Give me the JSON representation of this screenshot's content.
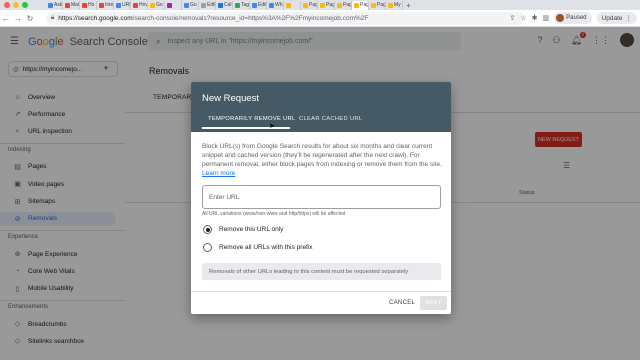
{
  "browser": {
    "tabs": [
      {
        "label": "Ask",
        "color": "#4285f4"
      },
      {
        "label": "Mai",
        "color": "#ea4335"
      },
      {
        "label": "Ho",
        "color": "#ea4335"
      },
      {
        "label": "Inte",
        "color": "#ea4335"
      },
      {
        "label": "URL",
        "color": "#4285f4"
      },
      {
        "label": "Hov",
        "color": "#ea4335"
      },
      {
        "label": "Go",
        "color": "#fbbc05"
      },
      {
        "label": "",
        "color": "#9c27b0"
      },
      {
        "label": "Go",
        "color": "#4285f4"
      },
      {
        "label": "Edit",
        "color": "#9e9e9e"
      },
      {
        "label": "Cal",
        "color": "#1a73e8"
      },
      {
        "label": "Tag",
        "color": "#34a853"
      },
      {
        "label": "Edit",
        "color": "#4285f4"
      },
      {
        "label": "Wh",
        "color": "#4285f4"
      },
      {
        "label": "",
        "color": "#fbbc05"
      },
      {
        "label": "Pag",
        "color": "#fbbc05"
      },
      {
        "label": "Pag",
        "color": "#fbbc05"
      },
      {
        "label": "Pag",
        "color": "#fbbc05"
      },
      {
        "label": "Pag",
        "color": "#fbbc05"
      },
      {
        "label": "Pag",
        "color": "#fbbc05"
      },
      {
        "label": "My",
        "color": "#fbbc05"
      }
    ],
    "new_tab": "+",
    "url_host": "https://search.google.com",
    "url_path": "/search-console/removals?resource_id=https%3A%2F%2Fmyincomejob.com%2F",
    "profile_label": "Paused",
    "update_label": "Update"
  },
  "header": {
    "logo_g": "G",
    "logo_o1": "o",
    "logo_o2": "o",
    "logo_g2": "g",
    "logo_l": "l",
    "logo_e": "e",
    "logo_rest": "Search Console",
    "search_placeholder": "Inspect any URL in \"https://myincomejob.com/\"",
    "notification_count": "2"
  },
  "sidebar": {
    "property": "https://myincomejo...",
    "items": [
      {
        "label": "Overview",
        "icon": "home-icon",
        "glyph": "⌂"
      },
      {
        "label": "Performance",
        "icon": "performance-icon",
        "glyph": "↗"
      },
      {
        "label": "URL inspection",
        "icon": "search-icon",
        "glyph": "⌕"
      }
    ],
    "section_indexing": "Indexing",
    "indexing_items": [
      {
        "label": "Pages",
        "icon": "pages-icon",
        "glyph": "▤"
      },
      {
        "label": "Video pages",
        "icon": "video-icon",
        "glyph": "▣"
      },
      {
        "label": "Sitemaps",
        "icon": "sitemap-icon",
        "glyph": "⊞"
      },
      {
        "label": "Removals",
        "icon": "removals-icon",
        "glyph": "⊘"
      }
    ],
    "section_experience": "Experience",
    "experience_items": [
      {
        "label": "Page Experience",
        "icon": "page-experience-icon",
        "glyph": "⊕"
      },
      {
        "label": "Core Web Vitals",
        "icon": "vitals-icon",
        "glyph": "◔"
      },
      {
        "label": "Mobile Usability",
        "icon": "mobile-icon",
        "glyph": "▯"
      }
    ],
    "section_enhancements": "Enhancements",
    "enhancement_items": [
      {
        "label": "Breadcrumbs",
        "icon": "breadcrumbs-icon",
        "glyph": "◇"
      },
      {
        "label": "Sitelinks searchbox",
        "icon": "sitelinks-icon",
        "glyph": "◇"
      }
    ]
  },
  "main": {
    "title": "Removals",
    "tab": "TEMPORARY",
    "new_request": "NEW REQUEST",
    "status_col": "Status"
  },
  "dialog": {
    "title": "New Request",
    "tab1": "TEMPORARILY REMOVE URL",
    "tab2": "CLEAR CACHED URL",
    "description": "Block URL(s) from Google Search results for about six months and clear current snippet and cached version (they'll be regenerated after the next crawl). For permanent removal, either block pages from indexing or remove them from the site.",
    "learn_more": "Learn more",
    "input_placeholder": "Enter URL",
    "hint": "All URL variations (www/non-www and http/https) will be affected",
    "option1": "Remove this URL only",
    "option2": "Remove all URLs with this prefix",
    "note": "Removals of other URLs leading to this content must be requested separately",
    "cancel": "CANCEL",
    "next": "NEXT"
  }
}
